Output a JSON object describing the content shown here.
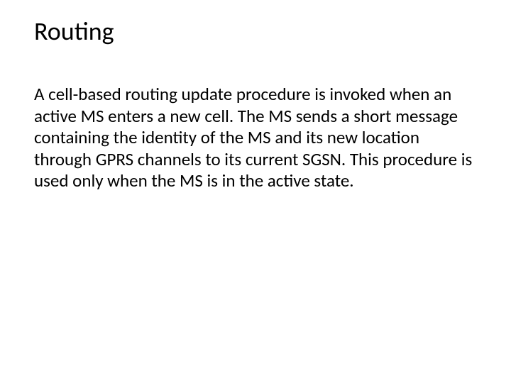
{
  "slide": {
    "title": "Routing",
    "body": "A cell-based routing update procedure is invoked when an active MS enters a new cell. The MS sends a short message containing the identity of the MS and its new location through GPRS channels to its current SGSN. This procedure is used only when the MS is in the active state."
  }
}
